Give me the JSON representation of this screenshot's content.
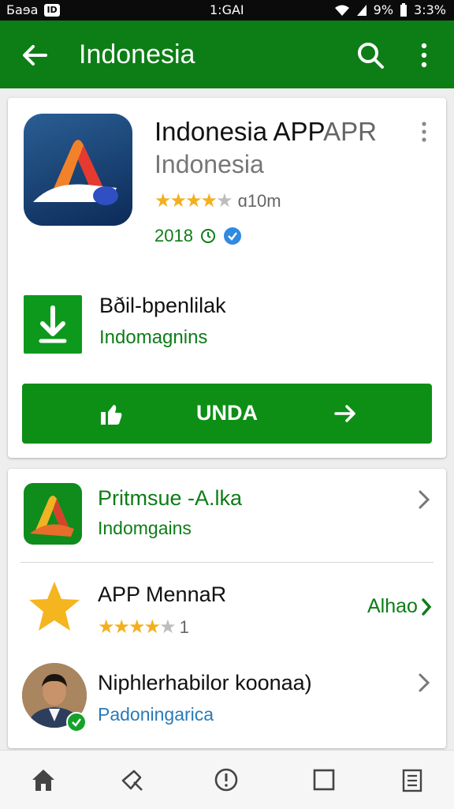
{
  "status_bar": {
    "left_text": "Ƃaɘa",
    "badge": "ID",
    "time": "1:GAI",
    "battery": "9%",
    "clock": "3:3%"
  },
  "app_bar": {
    "title": "Indonesia"
  },
  "app_card": {
    "name_main": "Indonesia APP",
    "name_fade": "APR",
    "developer": "Indonesia",
    "rating": 3.5,
    "rating_text": "ɑ10m",
    "year": "2018",
    "download": {
      "title": "Bðil-bpenlilak",
      "subtitle": "Indomagnins"
    },
    "install_label": "UNDA"
  },
  "related": [
    {
      "title": "Pritmsue -A.lka",
      "subtitle": "Indomgains"
    },
    {
      "title": "APP MennaR",
      "rating": 4,
      "rating_text": "1",
      "action": "Alhao"
    },
    {
      "title": "Niphlerhabilor koonaa)",
      "subtitle": "Padoningarica"
    }
  ],
  "bottom_nav": [
    "home-icon",
    "pin-icon",
    "info-icon",
    "square-icon",
    "list-icon"
  ],
  "colors": {
    "primary": "#0d7d16",
    "button": "#0d8f16",
    "star": "#f2b01e",
    "link": "#2a7ab8"
  }
}
